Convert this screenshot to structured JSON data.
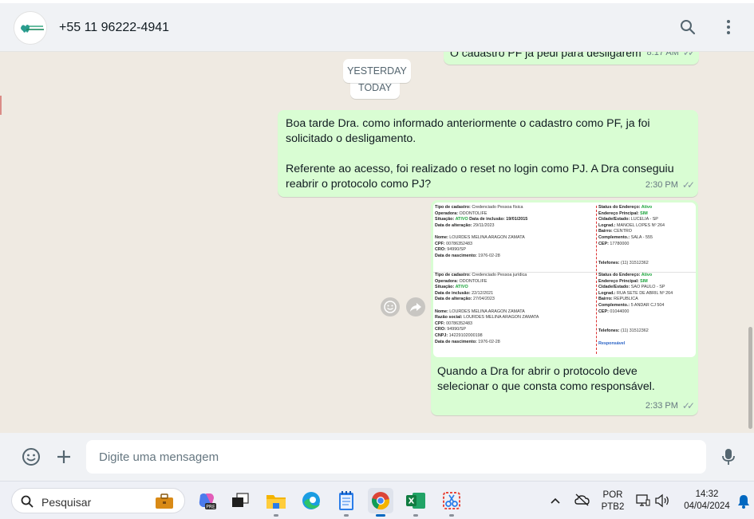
{
  "header": {
    "contact_name": "+55 11 96222-4941",
    "avatar_logo": "dental-clinic-logo",
    "search_icon": "search-icon",
    "menu_icon": "more-vertical-icon"
  },
  "chat": {
    "prev_message_fragment": "O cadastro PF já pedi para desligarem",
    "prev_message_time": "8:17 AM",
    "date_yesterday": "YESTERDAY",
    "date_today": "TODAY",
    "message1": {
      "line1": "Boa tarde Dra. como informado anteriormente o cadastro como PF, ja foi",
      "line2": "solicitado o desligamento.",
      "line3": "Referente ao acesso, foi realizado o reset no login como PJ. A Dra conseguiu",
      "line4": "reabrir o protocolo como PJ?",
      "time": "2:30 PM"
    },
    "image_message": {
      "caption_line1": "Quando a Dra for abrir o protocolo deve",
      "caption_line2": "selecionar o que consta como responsável.",
      "time": "2:33 PM",
      "doc": {
        "block1_left": [
          [
            "Tipo de cadastro:",
            "Credenciado Pessoa física"
          ],
          [
            "Operadora:",
            "ODONTOLIFE"
          ],
          [
            "Situação:",
            "ATIVO",
            "Data de inclusão: 19/01/2015"
          ],
          [
            "Data de alteração:",
            "29/11/2023"
          ],
          [
            "",
            ""
          ],
          [
            "Nome:",
            "LOURDES MELINA ARAGON ZAMATA"
          ],
          [
            "CPF:",
            "00786352483"
          ],
          [
            "CRO:",
            "94990/SP"
          ],
          [
            "Data de nascimento:",
            "1976-02-28"
          ]
        ],
        "block1_right": [
          [
            "Status do Endereço:",
            "Ativo"
          ],
          [
            "Endereço Principal:",
            "SIM"
          ],
          [
            "Cidade/Estado:",
            "LUCELIA - SP"
          ],
          [
            "Lograd.:",
            "MANOEL LOPES Nº 264"
          ],
          [
            "Bairro:",
            "CENTRO"
          ],
          [
            "Complemento.:",
            "SALA - 555"
          ],
          [
            "CEP:",
            "17780000"
          ]
        ],
        "block1_phone": [
          "Telefones:",
          "(11) 31512362"
        ],
        "block2_left": [
          [
            "Tipo de cadastro:",
            "Credenciado Pessoa jurídica"
          ],
          [
            "Operadora:",
            "ODONTOLIFE"
          ],
          [
            "Situação:",
            "ATIVO"
          ],
          [
            "Data de inclusão:",
            "22/12/2021"
          ],
          [
            "Data de alteração:",
            "27/04/2023"
          ],
          [
            "",
            ""
          ],
          [
            "Nome:",
            "LOURDES MELINA ARAGON ZAMATA"
          ],
          [
            "Razão social:",
            "LOURDES MELINA ARAGON ZAMATA"
          ],
          [
            "CPF:",
            "00786352483"
          ],
          [
            "CRO:",
            "94990/SP"
          ],
          [
            "CNPJ:",
            "14229102000198"
          ],
          [
            "Data de nascimento:",
            "1976-02-28"
          ]
        ],
        "block2_right": [
          [
            "Status do Endereço:",
            "Ativo"
          ],
          [
            "Endereço Principal:",
            "SIM"
          ],
          [
            "Cidade/Estado:",
            "SAO PAULO - SP"
          ],
          [
            "Lograd.:",
            "RUA SETE DE ABRIL Nº 264"
          ],
          [
            "Bairro:",
            "REPUBLICA"
          ],
          [
            "Complemento.:",
            "5 ANDAR CJ 504"
          ],
          [
            "CEP:",
            "01044000"
          ]
        ],
        "block2_phone": [
          "Telefones:",
          "(11) 31512362"
        ],
        "block2_responsavel": "Responsável"
      }
    }
  },
  "compose": {
    "placeholder": "Digite uma mensagem",
    "emoji_icon": "emoji-icon",
    "attach_icon": "plus-icon",
    "mic_icon": "microphone-icon"
  },
  "taskbar": {
    "search_placeholder": "Pesquisar",
    "lang_line1": "POR",
    "lang_line2": "PTB2",
    "time": "14:32",
    "date": "04/04/2024"
  },
  "colors": {
    "outgoing_bubble": "#d9fdd3",
    "chat_bg": "#efeae2",
    "header_bg": "#f0f2f5",
    "ticks": "#8696a0"
  }
}
